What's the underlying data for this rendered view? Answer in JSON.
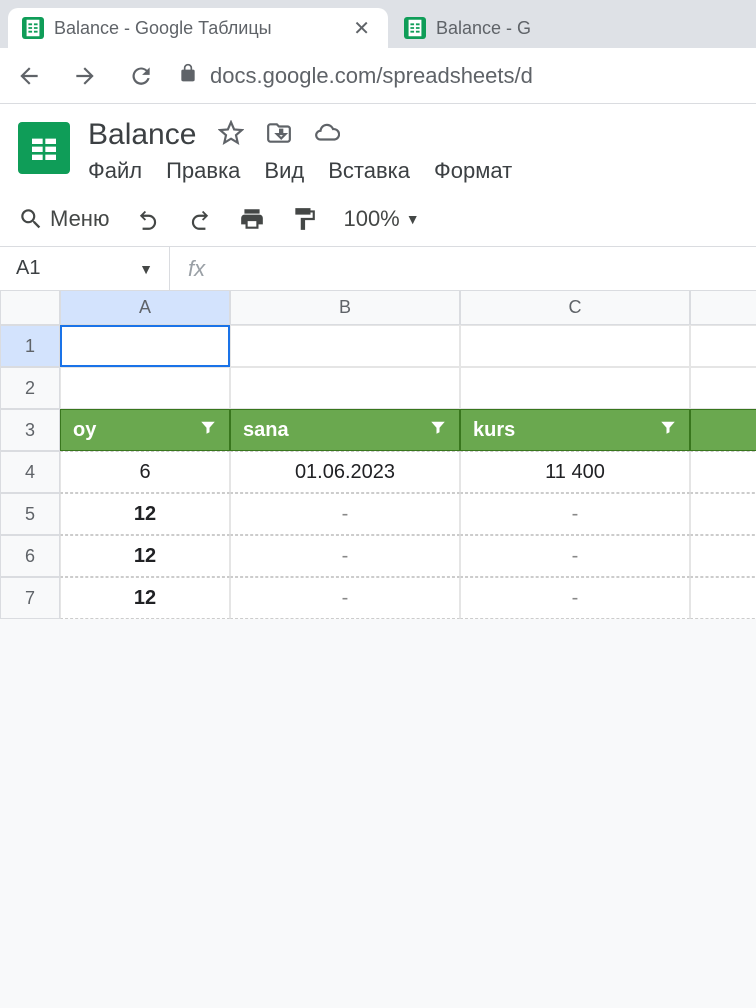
{
  "browser": {
    "tabs": [
      {
        "title": "Balance - Google Таблицы"
      },
      {
        "title": "Balance - G"
      }
    ],
    "url": "docs.google.com/spreadsheets/d"
  },
  "doc": {
    "title": "Balance",
    "menus": [
      "Файл",
      "Правка",
      "Вид",
      "Вставка",
      "Формат"
    ]
  },
  "toolbar": {
    "menu": "Меню",
    "zoom": "100%"
  },
  "namebox": "A1",
  "grid": {
    "cols": [
      "A",
      "B",
      "C"
    ],
    "rows": [
      "1",
      "2",
      "3",
      "4",
      "5",
      "6",
      "7"
    ],
    "headers": {
      "A": "oy",
      "B": "sana",
      "C": "kurs"
    },
    "data": [
      {
        "A": "6",
        "B": "01.06.2023",
        "C": "11 400"
      },
      {
        "A": "12",
        "B": "-",
        "C": "-"
      },
      {
        "A": "12",
        "B": "-",
        "C": "-"
      },
      {
        "A": "12",
        "B": "-",
        "C": "-"
      }
    ]
  }
}
